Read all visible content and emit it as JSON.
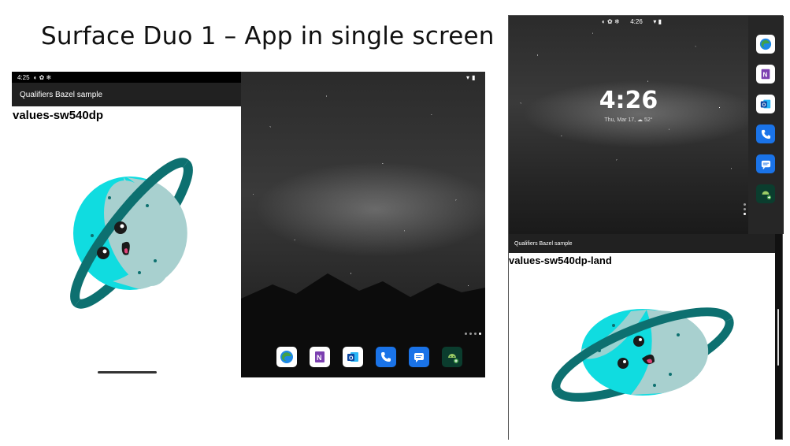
{
  "slide": {
    "title": "Surface Duo 1 – App in single screen"
  },
  "left_device": {
    "status_time": "4:25",
    "app_title": "Qualifiers Bazel sample",
    "qualifier_text": "values-sw540dp"
  },
  "right_device": {
    "status_time": "4:26",
    "lock_time": "4:26",
    "lock_date": "Thu, Mar 17,",
    "lock_weather": "52°",
    "app_title": "Qualifiers Bazel sample",
    "qualifier_text": "values-sw540dp-land"
  },
  "dock_apps": [
    {
      "name": "edge-icon",
      "color": "#ffffff"
    },
    {
      "name": "onenote-icon",
      "color": "#ffffff"
    },
    {
      "name": "outlook-icon",
      "color": "#ffffff"
    },
    {
      "name": "phone-icon",
      "color": "#1a73e8"
    },
    {
      "name": "messages-icon",
      "color": "#1a73e8"
    },
    {
      "name": "android-app-icon",
      "color": "#0b3d2e"
    }
  ],
  "colors": {
    "planet_cyan": "#10dce0",
    "planet_band": "#a8d0cf",
    "ring": "#0d7070",
    "appbar": "#212121"
  }
}
